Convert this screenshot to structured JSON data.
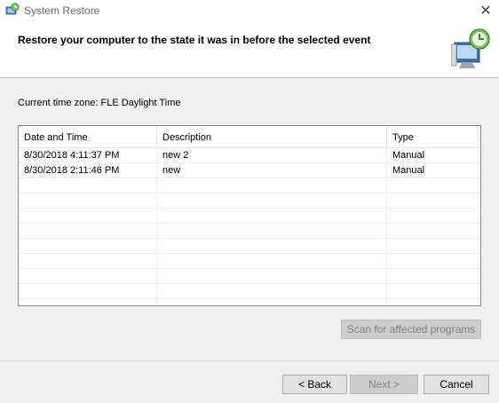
{
  "window": {
    "title": "System Restore",
    "close_glyph": "✕"
  },
  "header": {
    "instruction": "Restore your computer to the state it was in before the selected event",
    "icon": "system-restore-icon"
  },
  "timezone_label": "Current time zone: FLE Daylight Time",
  "list": {
    "columns": [
      "Date and Time",
      "Description",
      "Type"
    ],
    "sort_indicator": "ˇ",
    "rows": [
      {
        "date": "8/30/2018 4:11:37 PM",
        "description": "new 2",
        "type": "Manual"
      },
      {
        "date": "8/30/2018 2:11:46 PM",
        "description": "new",
        "type": "Manual"
      }
    ]
  },
  "buttons": {
    "scan": "Scan for affected programs",
    "back": "< Back",
    "next": "Next >",
    "cancel": "Cancel"
  }
}
